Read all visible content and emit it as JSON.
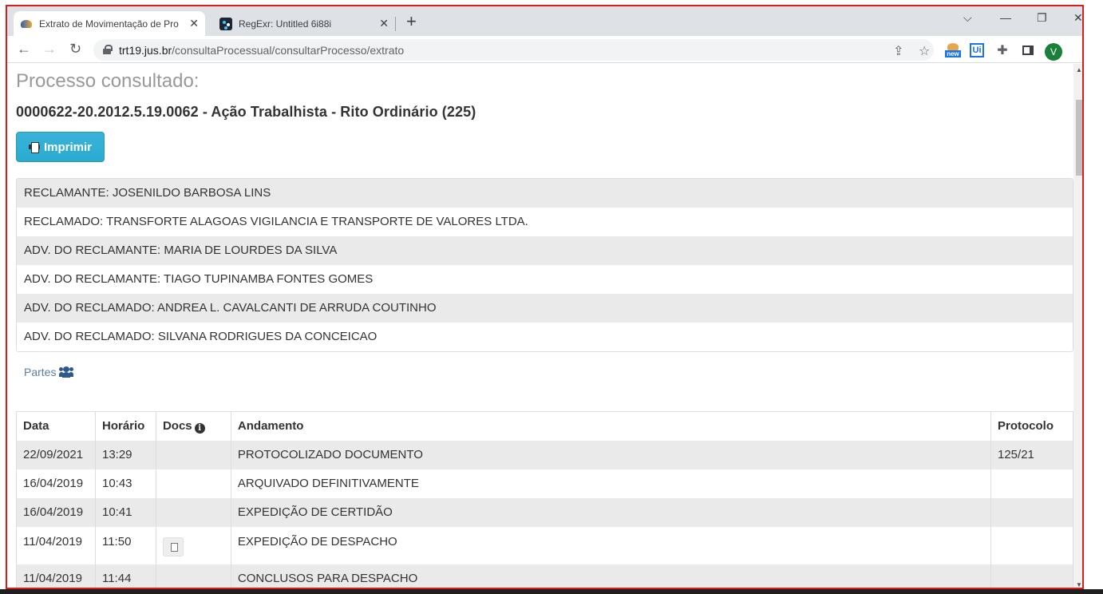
{
  "browser": {
    "tabs": [
      {
        "title": "Extrato de Movimentação de Pro",
        "active": true
      },
      {
        "title": "RegExr: Untitled 6i88i",
        "active": false
      }
    ],
    "url_domain": "trt19.jus.br",
    "url_path": "/consultaProcessual/consultarProcesso/extrato",
    "avatar_letter": "V",
    "ext_new_label": "new",
    "ext_ui_label": "Ui"
  },
  "page": {
    "label": "Processo consultado:",
    "title": "0000622-20.2012.5.19.0062 - Ação Trabalhista - Rito Ordinário (225)",
    "print_label": "Imprimir",
    "parties": [
      "RECLAMANTE: JOSENILDO BARBOSA LINS",
      "RECLAMADO: TRANSFORTE ALAGOAS VIGILANCIA E TRANSPORTE DE VALORES LTDA.",
      "ADV. DO RECLAMANTE: MARIA DE LOURDES DA SILVA",
      "ADV. DO RECLAMANTE: TIAGO TUPINAMBA FONTES GOMES",
      "ADV. DO RECLAMADO: ANDREA L. CAVALCANTI DE ARRUDA COUTINHO",
      "ADV. DO RECLAMADO: SILVANA RODRIGUES DA CONCEICAO"
    ],
    "partes_link": "Partes",
    "table": {
      "headers": {
        "data": "Data",
        "horario": "Horário",
        "docs": "Docs",
        "andamento": "Andamento",
        "protocolo": "Protocolo"
      },
      "rows": [
        {
          "data": "22/09/2021",
          "horario": "13:29",
          "andamento": "PROTOCOLIZADO DOCUMENTO",
          "protocolo": "125/21"
        },
        {
          "data": "16/04/2019",
          "horario": "10:43",
          "andamento": "ARQUIVADO DEFINITIVAMENTE",
          "protocolo": ""
        },
        {
          "data": "16/04/2019",
          "horario": "10:41",
          "andamento": "EXPEDIÇÃO DE CERTIDÃO",
          "protocolo": ""
        },
        {
          "data": "11/04/2019",
          "horario": "11:50",
          "andamento": "EXPEDIÇÃO DE DESPACHO",
          "protocolo": ""
        },
        {
          "data": "11/04/2019",
          "horario": "11:44",
          "andamento": "CONCLUSOS PARA DESPACHO",
          "protocolo": ""
        }
      ]
    }
  }
}
